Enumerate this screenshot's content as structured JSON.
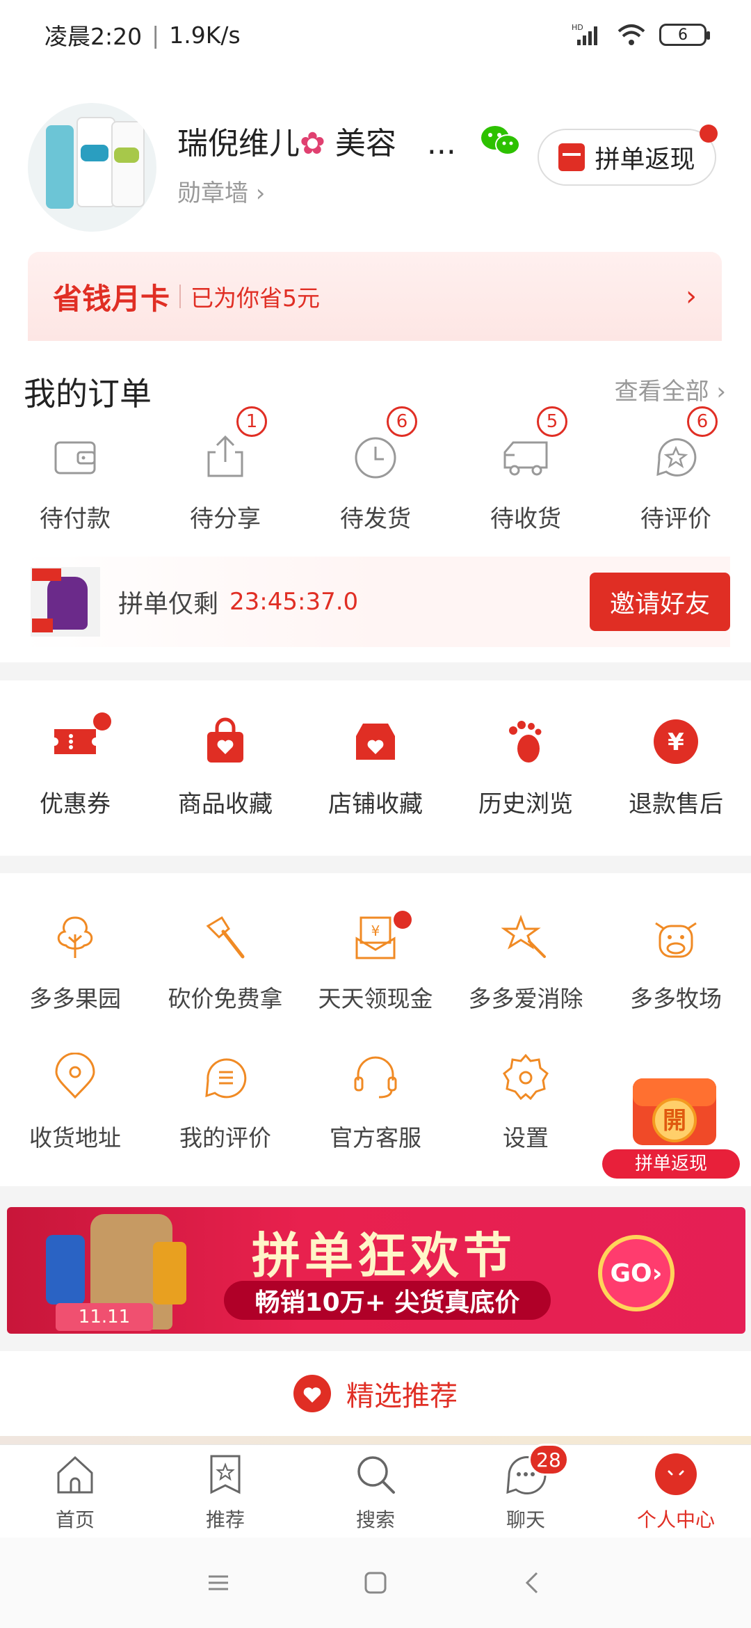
{
  "status": {
    "time": "凌晨2:20",
    "speed": "1.9K/s",
    "battery": "6"
  },
  "profile": {
    "name": "瑞倪维儿",
    "name_suffix": "美容",
    "ellipsis": "...",
    "medal_wall": "勋章墙 ›",
    "group_cashback": "拼单返现"
  },
  "save_card": {
    "title": "省钱月卡",
    "desc": "已为你省5元"
  },
  "orders": {
    "title": "我的订单",
    "view_all": "查看全部",
    "items": [
      {
        "label": "待付款",
        "badge": ""
      },
      {
        "label": "待分享",
        "badge": "1"
      },
      {
        "label": "待发货",
        "badge": "6"
      },
      {
        "label": "待收货",
        "badge": "5"
      },
      {
        "label": "待评价",
        "badge": "6"
      }
    ]
  },
  "group_bar": {
    "text": "拼单仅剩",
    "countdown": "23:45:37.0",
    "invite": "邀请好友"
  },
  "tools": [
    {
      "label": "优惠券",
      "icon": "coupon-icon"
    },
    {
      "label": "商品收藏",
      "icon": "bag-heart-icon"
    },
    {
      "label": "店铺收藏",
      "icon": "store-heart-icon"
    },
    {
      "label": "历史浏览",
      "icon": "footprint-icon"
    },
    {
      "label": "退款售后",
      "icon": "yen-circle-icon"
    }
  ],
  "games_row1": [
    {
      "label": "多多果园",
      "icon": "tree-icon"
    },
    {
      "label": "砍价免费拿",
      "icon": "axe-icon"
    },
    {
      "label": "天天领现金",
      "icon": "cash-envelope-icon"
    },
    {
      "label": "多多爱消除",
      "icon": "star-wand-icon"
    },
    {
      "label": "多多牧场",
      "icon": "cow-icon"
    }
  ],
  "games_row2": [
    {
      "label": "收货地址",
      "icon": "location-icon"
    },
    {
      "label": "我的评价",
      "icon": "comment-icon"
    },
    {
      "label": "官方客服",
      "icon": "headset-icon"
    },
    {
      "label": "设置",
      "icon": "gear-icon"
    }
  ],
  "float_promo": {
    "label": "拼单返现",
    "char": "開"
  },
  "banner": {
    "title": "拼单狂欢节",
    "subtitle": "畅销10万+ 尖货真底价",
    "go": "GO›",
    "date": "11.11"
  },
  "recommend": {
    "label": "精选推荐"
  },
  "tabbar": [
    {
      "label": "首页",
      "icon": "home-icon"
    },
    {
      "label": "推荐",
      "icon": "star-bookmark-icon"
    },
    {
      "label": "搜索",
      "icon": "search-icon"
    },
    {
      "label": "聊天",
      "icon": "chat-icon",
      "badge": "28"
    },
    {
      "label": "个人中心",
      "icon": "profile-icon"
    }
  ],
  "colors": {
    "accent": "#e02e24",
    "orange": "#f08a24"
  }
}
